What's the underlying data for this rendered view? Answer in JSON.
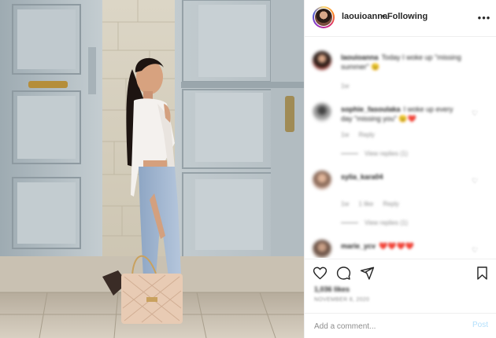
{
  "header": {
    "username": "laouioanna",
    "following_label": "• Following",
    "more_icon": "more-horizontal-icon"
  },
  "comments": [
    {
      "user": "laouioanna",
      "text": "Today I woke up \"missing summer\" 😉",
      "meta": [
        "1w"
      ]
    },
    {
      "user": "sophie_fasoulaka",
      "text": "I woke up every day \"missing you\" 😉❤️",
      "meta": [
        "1w",
        "Reply"
      ],
      "view_replies": "View replies (1)"
    },
    {
      "user": "sylia_kara04",
      "text": "",
      "meta": [
        "1w",
        "1 like",
        "Reply"
      ],
      "view_replies": "View replies (1)"
    },
    {
      "user": "marie_ycv",
      "text": "❤️❤️❤️❤️",
      "meta": []
    }
  ],
  "actions": {
    "like_icon": "heart-icon",
    "comment_icon": "comment-icon",
    "share_icon": "paper-plane-icon",
    "save_icon": "bookmark-icon",
    "likes_text": "1,036 likes",
    "date_text": "NOVEMBER 8, 2020"
  },
  "comment_box": {
    "placeholder": "Add a comment...",
    "post_label": "Post"
  },
  "colors": {
    "link_blue_disabled": "#b2dffc",
    "text_primary": "#262626",
    "text_secondary": "#8e8e8e",
    "border": "#efefef",
    "heart_red": "#e3283a"
  }
}
